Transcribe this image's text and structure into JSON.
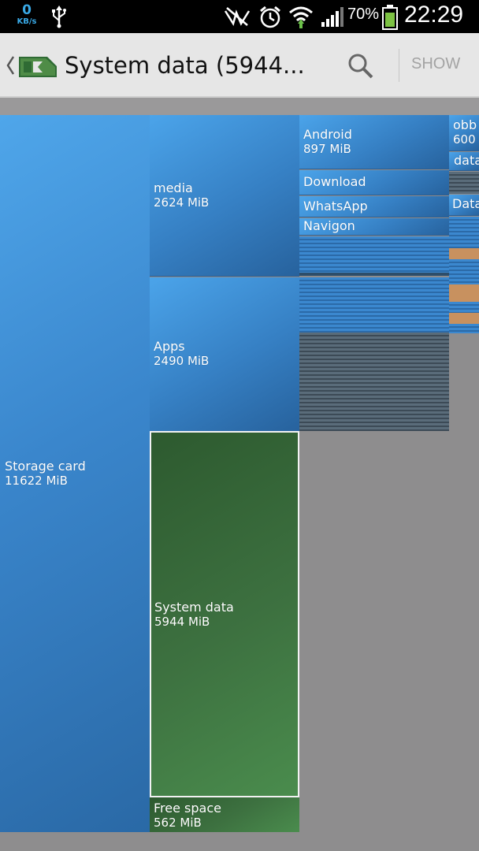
{
  "status_bar": {
    "network_speed": "0",
    "network_unit": "KB/s",
    "battery_percent": "70%",
    "battery_level": 0.7,
    "time": "22:29",
    "icons": [
      "usb-icon",
      "no-sim-icon",
      "alarm-icon",
      "wifi-icon",
      "signal-icon",
      "battery-icon"
    ]
  },
  "action_bar": {
    "title": "System data (5944...",
    "show_label": "SHOW",
    "icons": [
      "back-chevron-icon",
      "app-logo-icon",
      "search-icon"
    ]
  },
  "treemap": {
    "colors": {
      "folder": "#3a86cc",
      "selected": "#3d7140",
      "free": "#3d7140",
      "file": "#c8915f",
      "background": "#8e8d8e"
    },
    "storage_card": {
      "name": "Storage card",
      "size": "11622 MiB"
    },
    "media": {
      "name": "media",
      "size": "2624 MiB"
    },
    "apps": {
      "name": "Apps",
      "size": "2490 MiB"
    },
    "system_data": {
      "name": "System data",
      "size": "5944 MiB"
    },
    "free_space": {
      "name": "Free space",
      "size": "562 MiB"
    },
    "android": {
      "name": "Android",
      "size": "897 MiB"
    },
    "download": {
      "name": "Download"
    },
    "whatsapp": {
      "name": "WhatsApp"
    },
    "navigon": {
      "name": "Navigon"
    },
    "obb": {
      "name": "obb",
      "size": "600"
    },
    "data1": {
      "name": "data"
    },
    "data2": {
      "name": "Data"
    }
  }
}
